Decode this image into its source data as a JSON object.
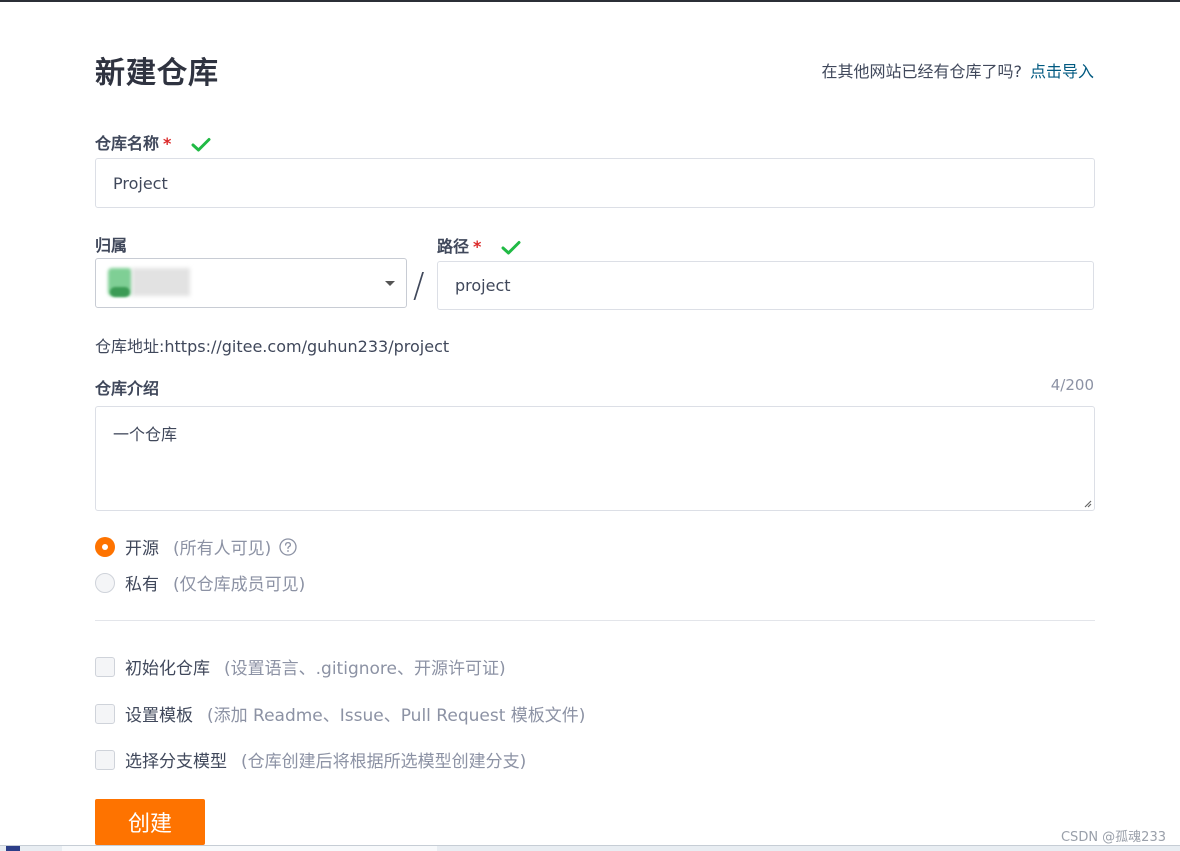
{
  "page": {
    "title": "新建仓库",
    "import_prompt": "在其他网站已经有仓库了吗?",
    "import_link": "点击导入"
  },
  "form": {
    "repo_name": {
      "label": "仓库名称",
      "required_mark": "*",
      "value": "Project"
    },
    "owner": {
      "label": "归属"
    },
    "path": {
      "label": "路径",
      "required_mark": "*",
      "value": "project"
    },
    "separator": "/",
    "repo_url": "仓库地址:https://gitee.com/guhun233/project",
    "description": {
      "label": "仓库介绍",
      "counter": "4/200",
      "value": "一个仓库"
    },
    "visibility": [
      {
        "label": "开源",
        "hint": "(所有人可见)",
        "selected": true
      },
      {
        "label": "私有",
        "hint": "(仅仓库成员可见)",
        "selected": false
      }
    ],
    "options": [
      {
        "label": "初始化仓库",
        "hint": "(设置语言、.gitignore、开源许可证)",
        "checked": false
      },
      {
        "label": "设置模板",
        "hint": "(添加 Readme、Issue、Pull Request 模板文件)",
        "checked": false
      },
      {
        "label": "选择分支模型",
        "hint": "(仓库创建后将根据所选模型创建分支)",
        "checked": false
      }
    ],
    "submit_label": "创建"
  },
  "watermark": "CSDN @孤魂233",
  "colors": {
    "accent": "#fe7300",
    "link": "#005980",
    "success": "#21ba45",
    "required": "#db2828"
  }
}
